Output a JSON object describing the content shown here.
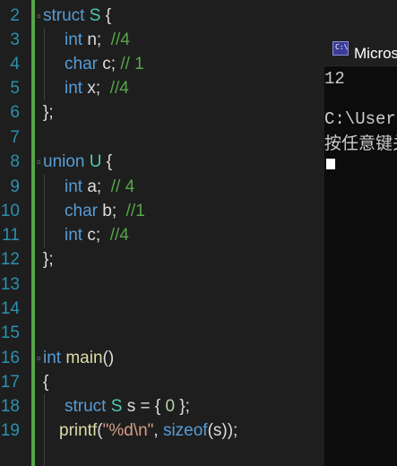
{
  "editor": {
    "line_numbers": [
      "2",
      "3",
      "4",
      "5",
      "6",
      "7",
      "8",
      "9",
      "10",
      "11",
      "12",
      "13",
      "14",
      "15",
      "16",
      "17",
      "18",
      "19"
    ],
    "colors": {
      "background": "#1e1e1e",
      "line_number": "#2b91af",
      "keyword": "#569cd6",
      "type": "#4ec9b0",
      "comment": "#57a64a",
      "function": "#dcdcaa",
      "string": "#d69d85",
      "number": "#b5cea8"
    },
    "code": {
      "l2": {
        "kw": "struct",
        "name": "S",
        "rest": " {"
      },
      "l3": {
        "kw": "int",
        "rest": " n;  ",
        "cmt": "//4"
      },
      "l4": {
        "kw": "char",
        "rest": " c; ",
        "cmt": "// 1"
      },
      "l5": {
        "kw": "int",
        "rest": " x;  ",
        "cmt": "//4"
      },
      "l6": {
        "rest": "};"
      },
      "l8": {
        "kw": "union",
        "name": "U",
        "rest": " {"
      },
      "l9": {
        "kw": "int",
        "rest": " a;  ",
        "cmt": "// 4"
      },
      "l10": {
        "kw": "char",
        "rest": " b;  ",
        "cmt": "//1"
      },
      "l11": {
        "kw": "int",
        "rest": " c;  ",
        "cmt": "//4"
      },
      "l12": {
        "rest": "};"
      },
      "l16": {
        "kw": "int",
        "fn": "main",
        "rest": "()"
      },
      "l17": {
        "rest": "{"
      },
      "l18": {
        "kw": "struct",
        "name": "S",
        "rest1": " s = { ",
        "num": "0",
        "rest2": " };"
      },
      "l19": {
        "fn": "printf",
        "p1": "(",
        "str": "\"%d\\n\"",
        "p2": ", ",
        "kw": "sizeof",
        "p3": "(s));"
      }
    }
  },
  "console": {
    "title": "Microsoft Visual Studio 调试控制台",
    "icon_name": "console-app-icon",
    "output_line1": "12",
    "output_line2": "C:\\Users",
    "output_line3": "按任意键关闭此窗口"
  }
}
